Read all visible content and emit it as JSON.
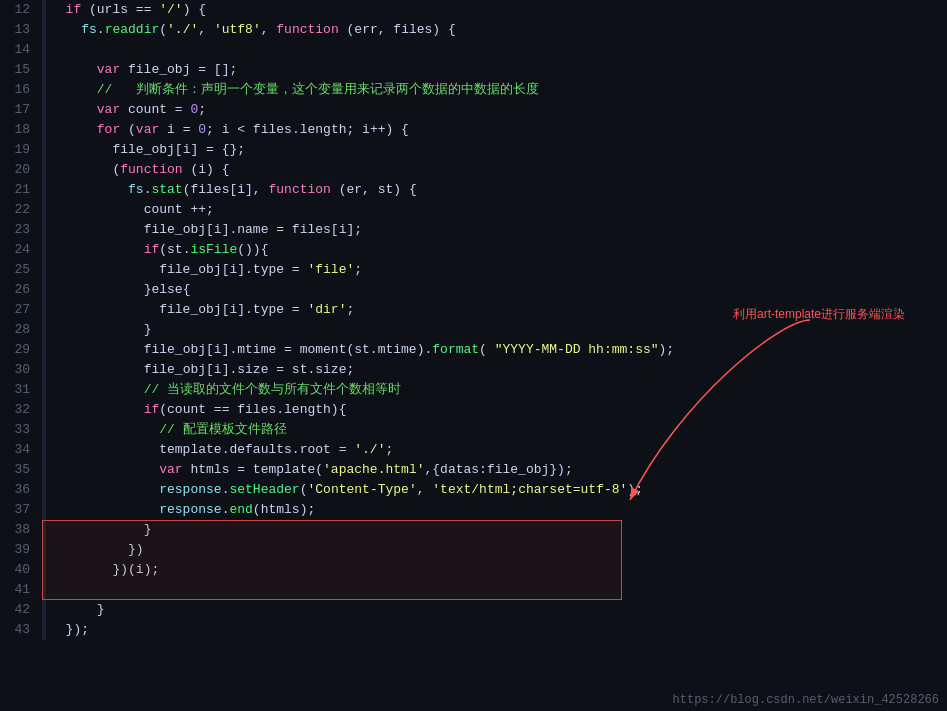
{
  "footer_url": "https://blog.csdn.net/weixin_42528266",
  "annotation": "利用art-template进行服务端渲染",
  "lines": [
    {
      "num": "12",
      "tokens": [
        {
          "t": "  ",
          "c": ""
        },
        {
          "t": "if",
          "c": "kw"
        },
        {
          "t": " (urls == ",
          "c": ""
        },
        {
          "t": "'/'",
          "c": "str"
        },
        {
          "t": ") {",
          "c": ""
        }
      ]
    },
    {
      "num": "13",
      "tokens": [
        {
          "t": "    ",
          "c": ""
        },
        {
          "t": "fs",
          "c": "prop"
        },
        {
          "t": ".",
          "c": ""
        },
        {
          "t": "readdir",
          "c": "fn"
        },
        {
          "t": "(",
          "c": ""
        },
        {
          "t": "'./''",
          "c": "str"
        },
        {
          "t": ", ",
          "c": ""
        },
        {
          "t": "'utf8'",
          "c": "str"
        },
        {
          "t": ", ",
          "c": ""
        },
        {
          "t": "function",
          "c": "kw"
        },
        {
          "t": " (err, files) {",
          "c": ""
        }
      ]
    },
    {
      "num": "14",
      "tokens": []
    },
    {
      "num": "15",
      "tokens": [
        {
          "t": "      ",
          "c": ""
        },
        {
          "t": "var",
          "c": "kw"
        },
        {
          "t": " file_obj = [];",
          "c": ""
        }
      ]
    },
    {
      "num": "16",
      "tokens": [
        {
          "t": "      ",
          "c": ""
        },
        {
          "t": "//   判断条件：声明一个变量，这个变量用来记录两个数据的中数据的长度",
          "c": "comment-cn"
        }
      ]
    },
    {
      "num": "17",
      "tokens": [
        {
          "t": "      ",
          "c": ""
        },
        {
          "t": "var",
          "c": "kw"
        },
        {
          "t": " count = ",
          "c": ""
        },
        {
          "t": "0",
          "c": "num"
        },
        {
          "t": ";",
          "c": ""
        }
      ]
    },
    {
      "num": "18",
      "tokens": [
        {
          "t": "      ",
          "c": ""
        },
        {
          "t": "for",
          "c": "kw"
        },
        {
          "t": " (",
          "c": ""
        },
        {
          "t": "var",
          "c": "kw"
        },
        {
          "t": " i = ",
          "c": ""
        },
        {
          "t": "0",
          "c": "num"
        },
        {
          "t": "; i < files.length; i++) {",
          "c": ""
        }
      ]
    },
    {
      "num": "19",
      "tokens": [
        {
          "t": "        ",
          "c": ""
        },
        {
          "t": "file_obj[i] = {};",
          "c": ""
        }
      ]
    },
    {
      "num": "20",
      "tokens": [
        {
          "t": "        ",
          "c": ""
        },
        {
          "t": "(",
          "c": ""
        },
        {
          "t": "function",
          "c": "kw"
        },
        {
          "t": " (i) {",
          "c": ""
        }
      ]
    },
    {
      "num": "21",
      "tokens": [
        {
          "t": "          ",
          "c": ""
        },
        {
          "t": "fs",
          "c": "prop"
        },
        {
          "t": ".",
          "c": ""
        },
        {
          "t": "stat",
          "c": "fn"
        },
        {
          "t": "(files[i], ",
          "c": ""
        },
        {
          "t": "function",
          "c": "kw"
        },
        {
          "t": " (er, st) {",
          "c": ""
        }
      ]
    },
    {
      "num": "22",
      "tokens": [
        {
          "t": "            ",
          "c": ""
        },
        {
          "t": "count ++;",
          "c": ""
        }
      ]
    },
    {
      "num": "23",
      "tokens": [
        {
          "t": "            ",
          "c": ""
        },
        {
          "t": "file_obj[i].name = files[i];",
          "c": ""
        }
      ]
    },
    {
      "num": "24",
      "tokens": [
        {
          "t": "            ",
          "c": ""
        },
        {
          "t": "if",
          "c": "kw"
        },
        {
          "t": "(st.",
          "c": ""
        },
        {
          "t": "isFile",
          "c": "fn"
        },
        {
          "t": "()){",
          "c": ""
        }
      ]
    },
    {
      "num": "25",
      "tokens": [
        {
          "t": "              ",
          "c": ""
        },
        {
          "t": "file_obj[i].type = ",
          "c": ""
        },
        {
          "t": "'file'",
          "c": "str"
        },
        {
          "t": ";",
          "c": ""
        }
      ]
    },
    {
      "num": "26",
      "tokens": [
        {
          "t": "            ",
          "c": ""
        },
        {
          "t": "}else{",
          "c": ""
        }
      ]
    },
    {
      "num": "27",
      "tokens": [
        {
          "t": "              ",
          "c": ""
        },
        {
          "t": "file_obj[i].type = ",
          "c": ""
        },
        {
          "t": "'dir'",
          "c": "str"
        },
        {
          "t": ";",
          "c": ""
        }
      ]
    },
    {
      "num": "28",
      "tokens": [
        {
          "t": "            ",
          "c": ""
        },
        {
          "t": "}",
          "c": ""
        }
      ]
    },
    {
      "num": "29",
      "tokens": [
        {
          "t": "            ",
          "c": ""
        },
        {
          "t": "file_obj[i].mtime = moment(st.mtime).",
          "c": ""
        },
        {
          "t": "format",
          "c": "fn"
        },
        {
          "t": "( ",
          "c": ""
        },
        {
          "t": "\"YYYY-MM-DD hh:mm:ss\"",
          "c": "str"
        },
        {
          "t": ");",
          "c": ""
        }
      ]
    },
    {
      "num": "30",
      "tokens": [
        {
          "t": "            ",
          "c": ""
        },
        {
          "t": "file_obj[i].size = st.size;",
          "c": ""
        }
      ]
    },
    {
      "num": "31",
      "tokens": [
        {
          "t": "            ",
          "c": ""
        },
        {
          "t": "// 当读取的文件个数与所有文件个数相等时",
          "c": "comment-cn"
        }
      ]
    },
    {
      "num": "32",
      "tokens": [
        {
          "t": "            ",
          "c": ""
        },
        {
          "t": "if",
          "c": "kw"
        },
        {
          "t": "(count == files.length){",
          "c": ""
        }
      ]
    },
    {
      "num": "33",
      "tokens": [
        {
          "t": "              ",
          "c": ""
        },
        {
          "t": "// 配置模板文件路径",
          "c": "comment-cn"
        }
      ]
    },
    {
      "num": "34",
      "tokens": [
        {
          "t": "              ",
          "c": ""
        },
        {
          "t": "template.defaults.root = ",
          "c": ""
        },
        {
          "t": "'./'",
          "c": "str"
        },
        {
          "t": ";",
          "c": ""
        }
      ]
    },
    {
      "num": "35",
      "tokens": [
        {
          "t": "              ",
          "c": ""
        },
        {
          "t": "var",
          "c": "kw"
        },
        {
          "t": " htmls = template(",
          "c": ""
        },
        {
          "t": "'apache.html'",
          "c": "str"
        },
        {
          "t": ",{datas:file_obj});",
          "c": ""
        }
      ]
    },
    {
      "num": "36",
      "tokens": [
        {
          "t": "              ",
          "c": ""
        },
        {
          "t": "response",
          "c": "prop"
        },
        {
          "t": ".",
          "c": ""
        },
        {
          "t": "setHeader",
          "c": "fn"
        },
        {
          "t": "(",
          "c": ""
        },
        {
          "t": "'Content-Type'",
          "c": "str"
        },
        {
          "t": ", ",
          "c": ""
        },
        {
          "t": "'text/html;charset=utf-8'",
          "c": "str"
        },
        {
          "t": ");",
          "c": ""
        }
      ]
    },
    {
      "num": "37",
      "tokens": [
        {
          "t": "              ",
          "c": ""
        },
        {
          "t": "response",
          "c": "prop"
        },
        {
          "t": ".",
          "c": ""
        },
        {
          "t": "end",
          "c": "fn"
        },
        {
          "t": "(htmls);",
          "c": ""
        }
      ]
    },
    {
      "num": "38",
      "tokens": [
        {
          "t": "            ",
          "c": ""
        },
        {
          "t": "}",
          "c": ""
        }
      ]
    },
    {
      "num": "39",
      "tokens": [
        {
          "t": "          ",
          "c": ""
        },
        {
          "t": "})",
          "c": ""
        }
      ]
    },
    {
      "num": "40",
      "tokens": [
        {
          "t": "        ",
          "c": ""
        },
        {
          "t": "})(i);",
          "c": ""
        }
      ]
    },
    {
      "num": "41",
      "tokens": []
    },
    {
      "num": "42",
      "tokens": [
        {
          "t": "      ",
          "c": ""
        },
        {
          "t": "}",
          "c": ""
        }
      ]
    },
    {
      "num": "43",
      "tokens": [
        {
          "t": "  ",
          "c": ""
        },
        {
          "t": "});",
          "c": ""
        }
      ]
    }
  ]
}
